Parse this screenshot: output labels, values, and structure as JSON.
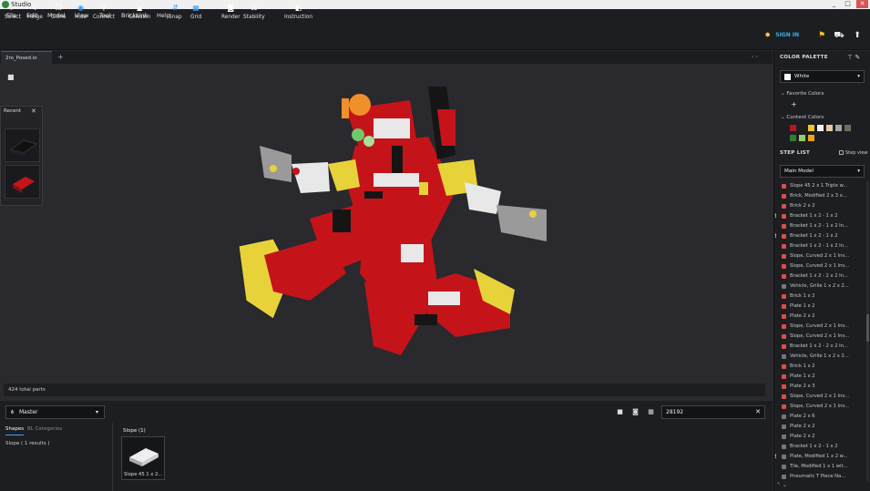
{
  "window": {
    "title": "Studio",
    "controls": [
      "_",
      "□",
      "✕"
    ]
  },
  "menu": [
    "File",
    "Edit",
    "Model",
    "View",
    "Tool",
    "BrickLink",
    "Help"
  ],
  "toolbar": [
    {
      "label": "Select",
      "icon": "cursor-icon",
      "glyph": "➤"
    },
    {
      "label": "Hinge",
      "icon": "hinge-icon",
      "glyph": "↻"
    },
    {
      "label": "Clone",
      "icon": "clone-icon",
      "glyph": "❐"
    },
    {
      "label": "Hide",
      "icon": "eye-icon",
      "glyph": "◉"
    },
    {
      "label": "Connect",
      "icon": "connect-icon",
      "glyph": "⚲"
    },
    {
      "label": "Collision",
      "icon": "collision-icon",
      "glyph": "▲"
    },
    {
      "label": "Snap",
      "icon": "snap-icon",
      "glyph": "⇵"
    },
    {
      "label": "Grid",
      "icon": "grid-icon",
      "glyph": "▦"
    },
    {
      "label": "Render",
      "icon": "camera-icon",
      "glyph": "◙"
    },
    {
      "label": "Stability",
      "icon": "stability-icon",
      "glyph": "⚖"
    },
    {
      "label": "Instruction",
      "icon": "instruction-icon",
      "glyph": "◧"
    }
  ],
  "signin": "SIGN IN",
  "tabs": {
    "file": "2ro_Posed.io",
    "add": "+"
  },
  "viewport": {
    "recent_title": "Recent",
    "parts_count": "424 total parts"
  },
  "bottom": {
    "master": "Master",
    "search_value": "28192",
    "tabs": [
      "Shapes",
      "BL Categories"
    ],
    "results": "Slope ( 1 results )",
    "group_title": "Slope (1)",
    "card_label": "Slope 45 1 x 2..."
  },
  "panel": {
    "color_palette_title": "COLOR PALETTE",
    "selected_color": "White",
    "favorite_title": "Favorite Colors",
    "content_title": "Content Colors",
    "content_colors": [
      "#b0191c",
      "#1f1f1f",
      "#f2c230",
      "#f4f4f4",
      "#e5c9a0",
      "#a3a3a3",
      "#6a7060",
      "#2e7d32",
      "#8fcf6a",
      "#f0a020"
    ],
    "step_list_title": "STEP LIST",
    "step_view": "Step view",
    "model": "Main Model"
  },
  "steps": [
    {
      "t": "Slope 45 2 x 1 Triple w...",
      "c": "#d9504a",
      "w": false
    },
    {
      "t": "Brick, Modified 2 x 3 x...",
      "c": "#d9504a",
      "w": false
    },
    {
      "t": "Brick 2 x 2",
      "c": "#d9504a",
      "w": false
    },
    {
      "t": "Bracket 1 x 2 - 1 x 2",
      "c": "#d9504a",
      "w": true
    },
    {
      "t": "Bracket 1 x 2 - 1 x 2 In...",
      "c": "#d9504a",
      "w": false
    },
    {
      "t": "Bracket 1 x 2 - 1 x 2",
      "c": "#d9504a",
      "w": true
    },
    {
      "t": "Bracket 1 x 2 - 1 x 2 In...",
      "c": "#d9504a",
      "w": false
    },
    {
      "t": "Slope, Curved 2 x 1 Inv...",
      "c": "#d9504a",
      "w": false
    },
    {
      "t": "Slope, Curved 2 x 1 Inv...",
      "c": "#d9504a",
      "w": false
    },
    {
      "t": "Bracket 1 x 2 - 2 x 2 In...",
      "c": "#d9504a",
      "w": false
    },
    {
      "t": "Vehicle, Grille 1 x 2 x 2...",
      "c": "#777777",
      "w": false
    },
    {
      "t": "Brick 1 x 2",
      "c": "#d9504a",
      "w": false
    },
    {
      "t": "Plate 1 x 2",
      "c": "#d9504a",
      "w": false
    },
    {
      "t": "Plate 2 x 2",
      "c": "#d9504a",
      "w": false
    },
    {
      "t": "Slope, Curved 2 x 1 Inv...",
      "c": "#d9504a",
      "w": false
    },
    {
      "t": "Slope, Curved 2 x 1 Inv...",
      "c": "#d9504a",
      "w": false
    },
    {
      "t": "Bracket 1 x 2 - 2 x 2 In...",
      "c": "#d9504a",
      "w": false
    },
    {
      "t": "Vehicle, Grille 1 x 2 x 2...",
      "c": "#777777",
      "w": false
    },
    {
      "t": "Brick 1 x 2",
      "c": "#d9504a",
      "w": false
    },
    {
      "t": "Plate 1 x 2",
      "c": "#d9504a",
      "w": false
    },
    {
      "t": "Plate 2 x 3",
      "c": "#d9504a",
      "w": false
    },
    {
      "t": "Slope, Curved 2 x 1 Inv...",
      "c": "#d9504a",
      "w": false
    },
    {
      "t": "Slope, Curved 2 x 1 Inv...",
      "c": "#d9504a",
      "w": false
    },
    {
      "t": "Plate 2 x 6",
      "c": "#777777",
      "w": false
    },
    {
      "t": "Plate 2 x 2",
      "c": "#777777",
      "w": false
    },
    {
      "t": "Plate 2 x 2",
      "c": "#777777",
      "w": false
    },
    {
      "t": "Bracket 1 x 2 - 1 x 2",
      "c": "#777777",
      "w": false
    },
    {
      "t": "Plate, Modified 1 x 2 w...",
      "c": "#777777",
      "w": true
    },
    {
      "t": "Tile, Modified 1 x 1 wit...",
      "c": "#777777",
      "w": false
    },
    {
      "t": "Pneumatic T Piece Na...",
      "c": "#777777",
      "w": false
    }
  ]
}
